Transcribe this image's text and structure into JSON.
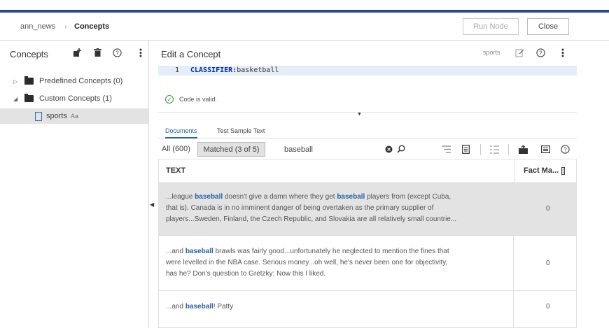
{
  "breadcrumb": {
    "root": "ann_news",
    "separator": "›",
    "current": "Concepts"
  },
  "header_buttons": {
    "run_node": "Run Node",
    "close": "Close"
  },
  "left_panel": {
    "title": "Concepts",
    "tree": [
      {
        "label": "Predefined Concepts (0)",
        "expanded": false
      },
      {
        "label": "Custom Concepts (1)",
        "expanded": true
      },
      {
        "label": "sports",
        "badge": "Aa"
      }
    ]
  },
  "editor": {
    "title": "Edit a Concept",
    "concept_tag": "sports",
    "line_number": "1",
    "keyword": "CLASSIFIER:",
    "value": "basketball",
    "status": "Code is valid."
  },
  "tabs": [
    {
      "label": "Documents"
    },
    {
      "label": "Test Sample Text"
    }
  ],
  "filter": {
    "all_label": "All (600)",
    "matched_label": "Matched (3 of 5)",
    "search_value": "baseball"
  },
  "table": {
    "headers": {
      "text": "TEXT",
      "fact": "Fact Ma..."
    },
    "rows": [
      {
        "lines": [
          [
            "...league ",
            "baseball",
            " doesn't give a damn where they get ",
            "baseball",
            " players from (except Cuba,"
          ],
          [
            "that is). Canada is in no imminent danger of being overtaken as the primary supplier of"
          ],
          [
            "players...Sweden, Finland, the Czech Republic, and Slovakia are all relatively small countrie..."
          ]
        ],
        "fact": "0"
      },
      {
        "lines": [
          [
            "...and ",
            "baseball",
            " brawls was fairly good...unfortunately he neglected to mention the fines that"
          ],
          [
            "were levelled in the NBA case. Serious money...oh well, he's never been one for objectivity,"
          ],
          [
            "has he? Don's question to Gretzky: Now this I liked."
          ]
        ],
        "fact": "0"
      },
      {
        "lines": [
          [
            "...and ",
            "baseball",
            "! Patty"
          ]
        ],
        "fact": "0"
      }
    ]
  }
}
